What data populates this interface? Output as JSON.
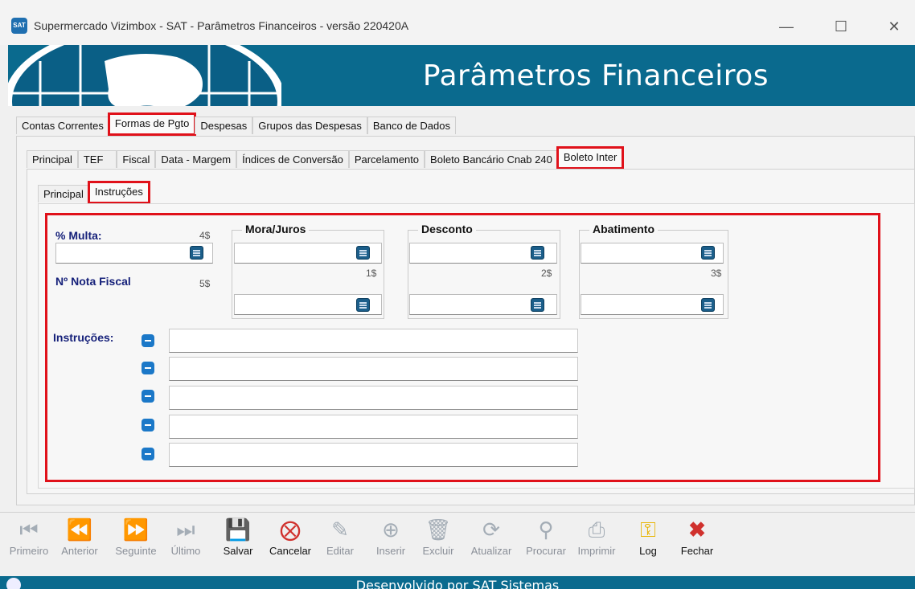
{
  "window": {
    "title": "Supermercado Vizimbox - SAT - Parâmetros Financeiros - versão 220420A",
    "app_icon_text": "SAT",
    "minimize": "—",
    "maximize": "☐",
    "close": "✕"
  },
  "banner": {
    "title": "Parâmetros Financeiros"
  },
  "main_tabs": [
    "Contas Correntes",
    "Formas de Pgto",
    "Despesas",
    "Grupos das Despesas",
    "Banco de Dados"
  ],
  "sub_tabs": [
    "Principal",
    "TEF",
    "Fiscal",
    "Data - Margem",
    "Índices de Conversão",
    "Parcelamento",
    "Boleto Bancário Cnab 240",
    "Boleto Inter"
  ],
  "sub2_tabs": [
    "Principal",
    "Instruções"
  ],
  "form": {
    "multa_label": "% Multa:",
    "multa_suffix": "4$",
    "nota_label": "Nº Nota Fiscal",
    "nota_suffix": "5$",
    "mora_title": "Mora/Juros",
    "mora_suffix": "1$",
    "desconto_title": "Desconto",
    "desconto_suffix": "2$",
    "abatimento_title": "Abatimento",
    "abatimento_suffix": "3$",
    "instrucoes_label": "Instruções:"
  },
  "toolbar": [
    {
      "label": "Primeiro",
      "icon": "first-icon",
      "enabled": false
    },
    {
      "label": "Anterior",
      "icon": "previous-icon",
      "enabled": false
    },
    {
      "label": "Seguinte",
      "icon": "next-icon",
      "enabled": false
    },
    {
      "label": "Último",
      "icon": "last-icon",
      "enabled": false
    },
    {
      "label": "Salvar",
      "icon": "save-icon",
      "enabled": true
    },
    {
      "label": "Cancelar",
      "icon": "cancel-icon",
      "enabled": true
    },
    {
      "label": "Editar",
      "icon": "edit-icon",
      "enabled": false
    },
    {
      "label": "Inserir",
      "icon": "insert-icon",
      "enabled": false
    },
    {
      "label": "Excluir",
      "icon": "delete-icon",
      "enabled": false
    },
    {
      "label": "Atualizar",
      "icon": "refresh-icon",
      "enabled": false
    },
    {
      "label": "Procurar",
      "icon": "search-icon",
      "enabled": false
    },
    {
      "label": "Imprimir",
      "icon": "print-icon",
      "enabled": false
    },
    {
      "label": "Log",
      "icon": "key-icon",
      "enabled": true
    },
    {
      "label": "Fechar",
      "icon": "close-icon",
      "enabled": true
    }
  ],
  "footer": {
    "text": "Desenvolvido por SAT Sistemas"
  },
  "colors": {
    "banner": "#0a6a8e",
    "highlight": "#e0111a",
    "label_blue": "#16217a",
    "icon_blue": "#1b78c8"
  }
}
